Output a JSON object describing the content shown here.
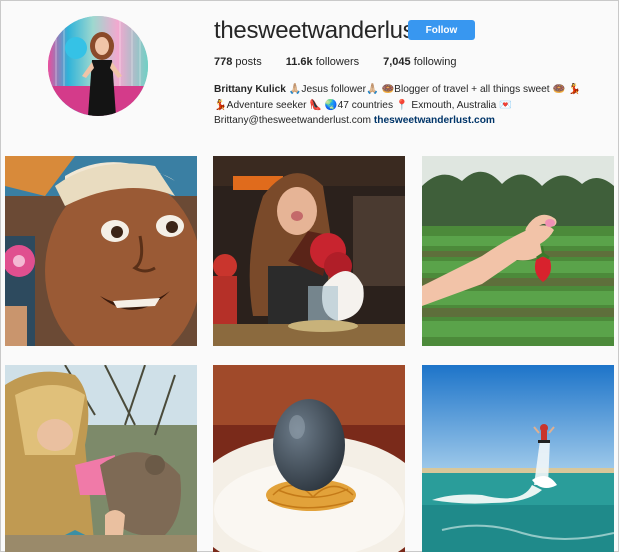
{
  "profile": {
    "username": "thesweetwanderlust",
    "follow_label": "Follow",
    "stats": {
      "posts": "778",
      "posts_label": "posts",
      "followers": "11.6k",
      "followers_label": "followers",
      "following": "7,045",
      "following_label": "following"
    },
    "bio": {
      "name": "Brittany Kulick",
      "line1_rest": " 🙏🏼Jesus follower🙏🏼 🍩Blogger of travel + all things sweet 🍩 💃",
      "line2": "💃Adventure seeker 👠 🌏47 countries 📍 Exmouth, Australia 💌",
      "email": "Brittany@thesweetwanderlust.com",
      "website": "thesweetwanderlust.com"
    }
  },
  "grid": {
    "posts": [
      {
        "subject": "street-art-mural"
      },
      {
        "subject": "dessert-freakshake"
      },
      {
        "subject": "strawberry-picking"
      },
      {
        "subject": "quokka-selfie"
      },
      {
        "subject": "chocolate-egg-dessert"
      },
      {
        "subject": "flyboard-ocean"
      }
    ]
  },
  "colors": {
    "follow_button": "#3897f0",
    "link": "#003569",
    "text": "#262626"
  }
}
